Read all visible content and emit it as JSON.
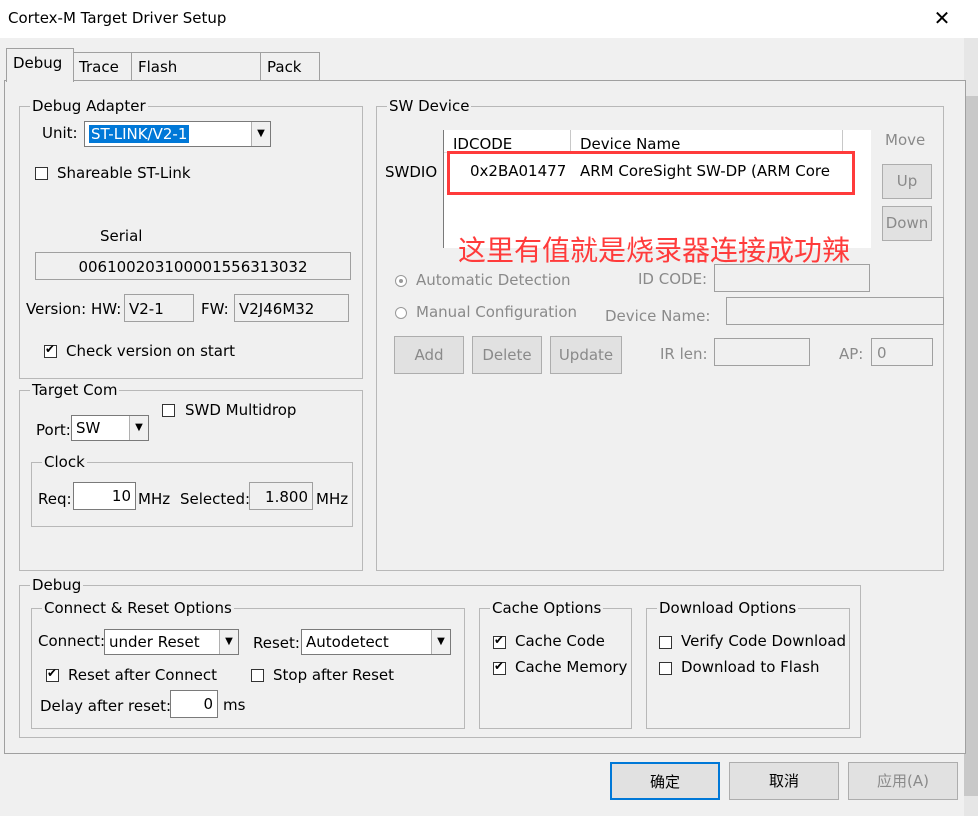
{
  "window": {
    "title": "Cortex-M Target Driver Setup",
    "close_glyph": "✕"
  },
  "tabs": [
    "Debug",
    "Trace",
    "Flash Download",
    "Pack"
  ],
  "debug_adapter": {
    "legend": "Debug Adapter",
    "unit_label": "Unit:",
    "unit_value": "ST-LINK/V2-1",
    "shareable_label": "Shareable ST-Link",
    "serial_label": "Serial",
    "serial_value": "0061002031000015563130​32",
    "version_label": "Version: HW:",
    "hw_value": "V2-1",
    "fw_label": "FW:",
    "fw_value": "V2J46M32",
    "check_version_label": "Check version on start"
  },
  "target_com": {
    "legend": "Target Com",
    "swd_multidrop_label": "SWD Multidrop",
    "port_label": "Port:",
    "port_value": "SW",
    "clock": {
      "legend": "Clock",
      "req_label": "Req:",
      "req_value": "10",
      "mhz1": "MHz",
      "selected_label": "Selected:",
      "selected_value": "1.800",
      "mhz2": "MHz"
    }
  },
  "sw_device": {
    "legend": "SW Device",
    "col_idcode": "IDCODE",
    "col_device_name": "Device Name",
    "row_label": "SWDIO",
    "idcode": "0x2BA01477",
    "device_name": "ARM CoreSight SW-DP (ARM Core",
    "move_label": "Move",
    "up_label": "Up",
    "down_label": "Down",
    "annotation": "这里有值就是烧录器连接成功辣",
    "auto_detect_label": "Automatic Detection",
    "manual_config_label": "Manual Configuration",
    "id_code_label": "ID CODE:",
    "device_name_label": "Device Name:",
    "add_label": "Add",
    "delete_label": "Delete",
    "update_label": "Update",
    "ir_len_label": "IR len:",
    "ap_label": "AP:",
    "ap_value": "0",
    "annotation_color": "#ff3b3b"
  },
  "debug": {
    "legend": "Debug",
    "connect_reset": {
      "legend": "Connect & Reset Options",
      "connect_label": "Connect:",
      "connect_value": "under Reset",
      "reset_label": "Reset:",
      "reset_value": "Autodetect",
      "reset_after_connect_label": "Reset after Connect",
      "stop_after_reset_label": "Stop after Reset",
      "delay_label": "Delay after reset:",
      "delay_value": "0",
      "ms_label": "ms"
    },
    "cache": {
      "legend": "Cache Options",
      "cache_code_label": "Cache Code",
      "cache_memory_label": "Cache Memory"
    },
    "download": {
      "legend": "Download Options",
      "verify_label": "Verify Code Download",
      "download_flash_label": "Download to Flash"
    }
  },
  "footer": {
    "ok": "确定",
    "cancel": "取消",
    "apply": "应用(A)"
  }
}
